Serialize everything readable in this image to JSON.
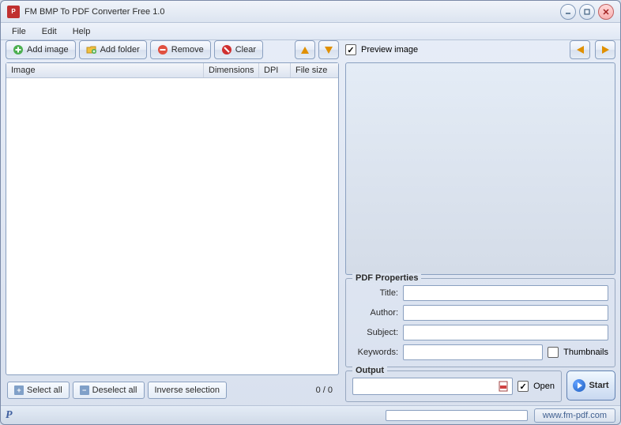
{
  "window": {
    "title": "FM BMP To PDF Converter Free 1.0"
  },
  "menu": {
    "file": "File",
    "edit": "Edit",
    "help": "Help"
  },
  "toolbar": {
    "add_image": "Add image",
    "add_folder": "Add folder",
    "remove": "Remove",
    "clear": "Clear"
  },
  "preview": {
    "label": "Preview image",
    "checked": true
  },
  "columns": {
    "image": "Image",
    "dimensions": "Dimensions",
    "dpi": "DPI",
    "filesize": "File size"
  },
  "selection": {
    "select_all": "Select all",
    "deselect_all": "Deselect all",
    "inverse": "Inverse selection",
    "counter": "0 / 0"
  },
  "pdf": {
    "legend": "PDF Properties",
    "title_label": "Title:",
    "author_label": "Author:",
    "subject_label": "Subject:",
    "keywords_label": "Keywords:",
    "thumbnails_label": "Thumbnails",
    "title": "",
    "author": "",
    "subject": "",
    "keywords": ""
  },
  "output": {
    "legend": "Output",
    "open_label": "Open",
    "open_checked": true,
    "path": ""
  },
  "start": "Start",
  "status": {
    "url": "www.fm-pdf.com"
  }
}
